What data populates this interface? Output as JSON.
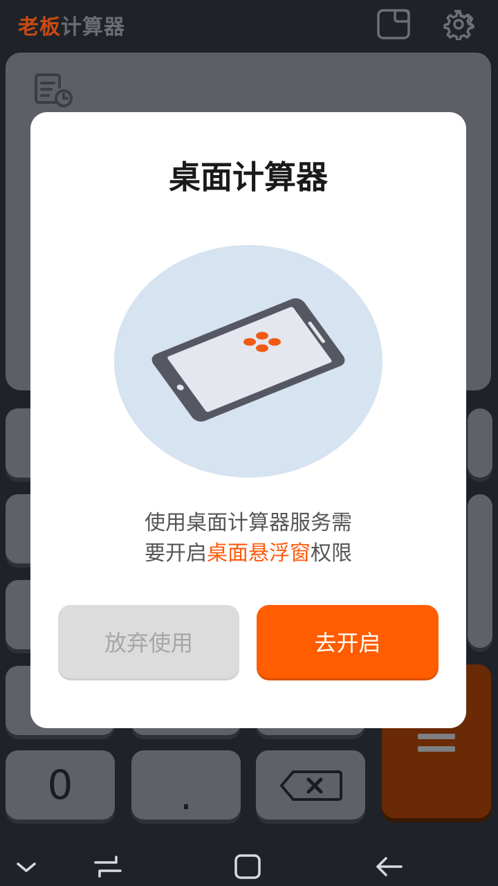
{
  "app": {
    "title_brand": "老板",
    "title_rest": "计算器",
    "colors": {
      "brand": "#c94a12",
      "accent": "#ff5d00",
      "highlight": "#ff5a0a"
    }
  },
  "header": {
    "icons": [
      "floating-window-icon",
      "settings-gear-icon"
    ]
  },
  "display": {
    "history_icon": "history-list-icon"
  },
  "keypad": {
    "zero_label": "0",
    "dot_label": ".",
    "backspace_icon": "backspace-icon",
    "equals_icon": "equals-icon"
  },
  "dialog": {
    "title": "桌面计算器",
    "message_line1": "使用桌面计算器服务需",
    "message_line2_prefix": "要开启",
    "message_line2_highlight": "桌面悬浮窗",
    "message_line2_suffix": "权限",
    "cancel_label": "放弃使用",
    "confirm_label": "去开启",
    "illustration_icon": "phone-illustration-icon"
  },
  "navbar": {
    "icons": [
      "collapse-chevron-icon",
      "recent-apps-icon",
      "home-icon",
      "back-icon"
    ]
  }
}
